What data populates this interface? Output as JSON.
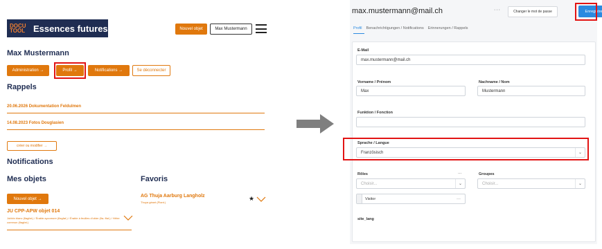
{
  "left": {
    "logo": {
      "mark_line1": "DOCU",
      "mark_line2": "TOOL",
      "title": "Essences futures"
    },
    "header": {
      "new_object_label": "Nouvel objet",
      "user_button_label": "Max Mustermann"
    },
    "user_name": "Max Mustermann",
    "nav": [
      {
        "label": "Administration  →"
      },
      {
        "label": "Profil  →"
      },
      {
        "label": "Notifications  →"
      },
      {
        "label": "Se déconnecter"
      }
    ],
    "reminders_title": "Rappels",
    "reminders": [
      {
        "label": "20.06.2026 Dokumentation Feldulmen"
      },
      {
        "label": "14.08.2023 Fotos Douglasien"
      }
    ],
    "edit_button_label": "créer ou modifier  →",
    "notifications_title": "Notifications",
    "my_objects_title": "Mes objets",
    "new_object_button": "Nouvel objet  →",
    "object": {
      "title": "JU CPP-APW objet 014",
      "description": "Jobbin blanc (flagfat.) / Érable-sycomore (flagfat.) / Érable à feuilles d'obier (fla- ffat.) / Hêtre commun (flagfat.)"
    },
    "favorites_title": "Favoris",
    "favorite": {
      "title": "AG Thuja Aarburg Langholz",
      "subtitle": "Thuya géant (Plant.)",
      "star": "★"
    }
  },
  "right": {
    "email_title": "max.mustermann@mail.ch",
    "menu_dots": "···",
    "change_password_label": "Changer le mot de passe",
    "save_label": "Enregistrer",
    "tabs": [
      {
        "label": "Profil"
      },
      {
        "label": "Benachrichtigungen / Notifications"
      },
      {
        "label": "Erinnerungen / Rappels"
      }
    ],
    "form": {
      "email_label": "E-Mail",
      "email_value": "max.mustermann@mail.ch",
      "firstname_label": "Vorname / Prénom",
      "firstname_value": "Max",
      "lastname_label": "Nachname / Nom",
      "lastname_value": "Mustermann",
      "function_label": "Funktion / Fonction",
      "function_value": "",
      "language_label": "Sprache / Langue",
      "language_value": "Französisch",
      "roles_label": "Rôles",
      "roles_dots": "···",
      "roles_placeholder": "Choisir...",
      "groups_label": "Groupes",
      "groups_placeholder": "Choisir...",
      "role_chip": "Visitor",
      "role_chip_dots": "···",
      "site_lang_label": "site_lang"
    }
  },
  "colors": {
    "accent": "#e0780d",
    "navy": "#1f2d52",
    "primary_blue": "#2b8ae0",
    "highlight": "#e21313"
  }
}
